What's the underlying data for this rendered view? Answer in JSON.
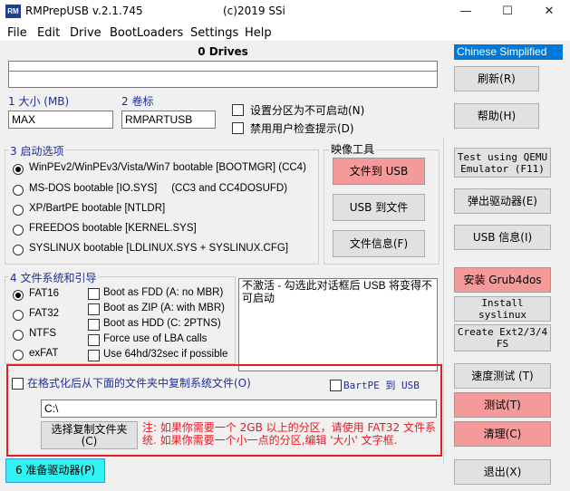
{
  "window": {
    "app_icon_text": "RM",
    "title": "RMPrepUSB v.2.1.745",
    "copyright": "(c)2019 SSi",
    "minimize": "—",
    "maximize": "☐",
    "close": "✕"
  },
  "menu": [
    "File",
    "Edit",
    "Drive",
    "BootLoaders",
    "Settings",
    "Help"
  ],
  "drives": {
    "title": "0 Drives"
  },
  "size": {
    "label": "1 大小 (MB)",
    "value": "MAX"
  },
  "volume": {
    "label": "2 卷标",
    "value": "RMPARTUSB"
  },
  "checks": {
    "no_boot": "设置分区为不可启动(N)",
    "no_user_prompt": "禁用用户检查提示(D)"
  },
  "boot_options": {
    "title": "3 启动选项",
    "items": [
      {
        "label": "WinPEv2/WinPEv3/Vista/Win7 bootable [BOOTMGR] (CC4)",
        "selected": true
      },
      {
        "label": "MS-DOS bootable [IO.SYS]     (CC3 and CC4DOSUFD)",
        "selected": false
      },
      {
        "label": "XP/BartPE bootable [NTLDR]",
        "selected": false
      },
      {
        "label": "FREEDOS bootable [KERNEL.SYS]",
        "selected": false
      },
      {
        "label": "SYSLINUX bootable [LDLINUX.SYS + SYSLINUX.CFG]",
        "selected": false
      }
    ]
  },
  "image_tools": {
    "title": "映像工具",
    "file_to_usb": "文件到 USB",
    "usb_to_file": "USB 到文件",
    "file_info": "文件信息(F)"
  },
  "filesystem": {
    "title": "4 文件系统和引导",
    "options": [
      {
        "label": "FAT16",
        "selected": true
      },
      {
        "label": "FAT32",
        "selected": false
      },
      {
        "label": "NTFS",
        "selected": false
      },
      {
        "label": "exFAT",
        "selected": false
      }
    ],
    "boot_as": [
      "Boot as FDD (A: no MBR)",
      "Boot as ZIP (A: with MBR)",
      "Boot as HDD (C: 2PTNS)",
      "Force use of LBA calls",
      "Use 64hd/32sec if possible"
    ]
  },
  "note": "不激活 - 勾选此对话框后 USB 将变得不可启动",
  "copy": {
    "checkbox": "在格式化后从下面的文件夹中复制系统文件(O)",
    "bartpe": "BartPE 到 USB",
    "folder": "C:\\",
    "choose_button_line1": "选择复制文件夹",
    "choose_button_line2": "(C)",
    "warning": "注: 如果你需要一个 2GB 以上的分区，请使用 FAT32 文件系统. 如果你需要一个小一点的分区,编辑 '大小' 文字框."
  },
  "prepare": "6 准备驱动器(P)",
  "language": "Chinese Simplified",
  "side": {
    "refresh": "刷新(R)",
    "help": "帮助(H)",
    "qemu_line1": "Test using QEMU",
    "qemu_line2": "Emulator (F11)",
    "eject": "弹出驱动器(E)",
    "usb_info": "USB 信息(I)",
    "grub4dos": "安装 Grub4dos",
    "syslinux": "Install syslinux",
    "ext_line1": "Create Ext2/3/4",
    "ext_line2": "FS",
    "speed_test": "速度测试 (T)",
    "test": "测试(T)",
    "clean": "清理(C)",
    "exit": "退出(X)"
  },
  "colors": {
    "red_button": "#f59a9a",
    "cyan_button": "#2ff2f2",
    "red_frame": "#e51c23",
    "dropdown": "#0078d7"
  }
}
